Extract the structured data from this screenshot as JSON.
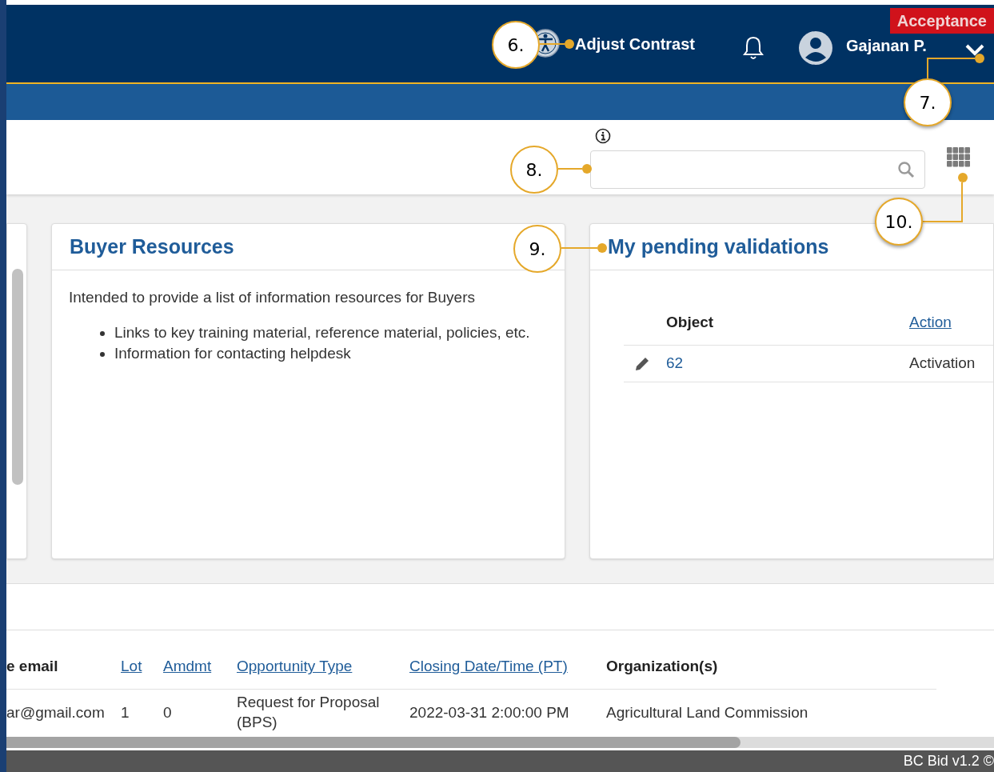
{
  "header": {
    "environment_badge": "Acceptance",
    "contrast_label": "Adjust Contrast",
    "user_name": "Gajanan P."
  },
  "callouts": [
    {
      "label": "6.",
      "kind": "left"
    },
    {
      "label": "7.",
      "kind": "elbow-up"
    },
    {
      "label": "8.",
      "kind": "left"
    },
    {
      "label": "9.",
      "kind": "left"
    },
    {
      "label": "10.",
      "kind": "elbow-right"
    }
  ],
  "buyer_resources": {
    "title": "Buyer Resources",
    "intro": "Intended to provide a list of information resources for Buyers",
    "bullets": [
      "Links to key training material, reference material, policies, etc.",
      "Information for contacting helpdesk"
    ]
  },
  "pending_validations": {
    "title": "My pending validations",
    "columns": [
      {
        "label": "Object",
        "link": false
      },
      {
        "label": "Action",
        "link": true
      }
    ],
    "rows": [
      {
        "object": "62",
        "action": "Activation"
      }
    ]
  },
  "opportunities": {
    "columns": [
      {
        "label": "e email",
        "link": false
      },
      {
        "label": "Lot",
        "link": true
      },
      {
        "label": "Amdmt",
        "link": true
      },
      {
        "label": "Opportunity Type",
        "link": true
      },
      {
        "label": "Closing Date/Time (PT)",
        "link": true
      },
      {
        "label": "Organization(s)",
        "link": false
      }
    ],
    "rows": [
      [
        "ar@gmail.com",
        "1",
        "0",
        "Request for Proposal (BPS)",
        "2022-03-31 2:00:00 PM",
        "Agricultural Land Commission"
      ]
    ]
  },
  "footer": {
    "text": "BC Bid v1.2 ©"
  }
}
